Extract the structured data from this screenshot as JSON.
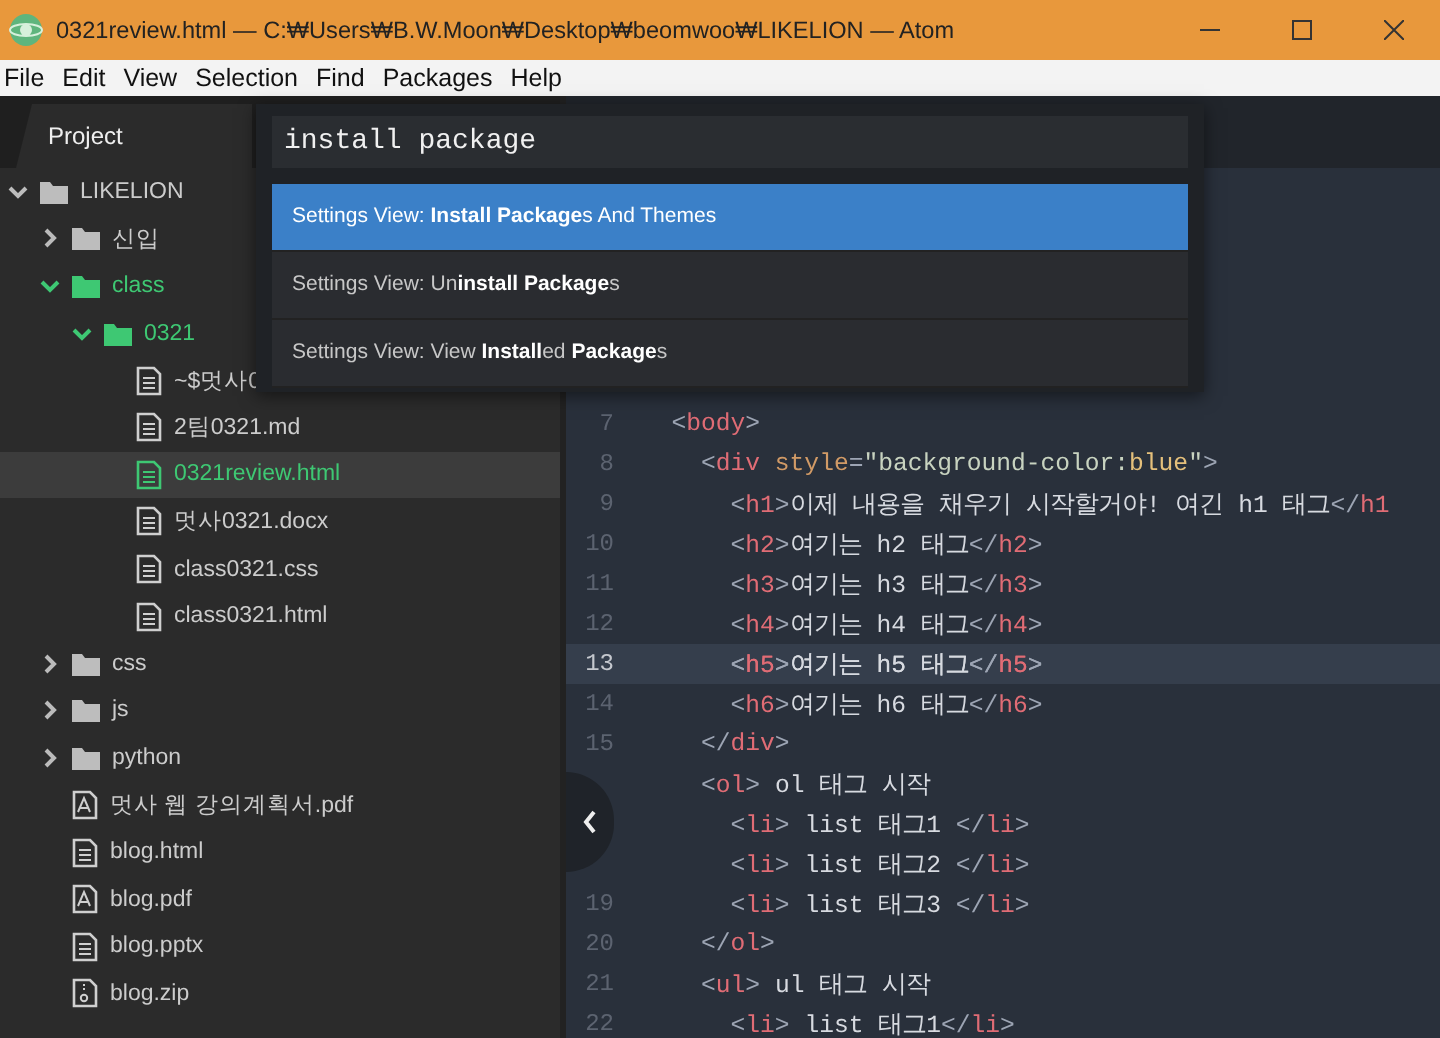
{
  "window": {
    "title": "0321review.html — C:₩Users₩B.W.Moon₩Desktop₩beomwoo₩LIKELION — Atom"
  },
  "menu": [
    "File",
    "Edit",
    "View",
    "Selection",
    "Find",
    "Packages",
    "Help"
  ],
  "sidebar": {
    "tab": "Project"
  },
  "tree": [
    {
      "label": "LIKELION",
      "kind": "folder",
      "expanded": true,
      "selected": false,
      "added": false,
      "children": [
        {
          "label": "신입",
          "kind": "folder",
          "expanded": false,
          "selected": false,
          "added": false
        },
        {
          "label": "class",
          "kind": "folder",
          "expanded": true,
          "selected": false,
          "added": true,
          "children": [
            {
              "label": "0321",
              "kind": "folder",
              "expanded": true,
              "selected": false,
              "added": true,
              "children": [
                {
                  "label": "~$멋사0",
                  "kind": "file",
                  "selected": false,
                  "added": false
                },
                {
                  "label": "2팀0321.md",
                  "kind": "file",
                  "selected": false,
                  "added": false
                },
                {
                  "label": "0321review.html",
                  "kind": "file",
                  "selected": true,
                  "added": true
                },
                {
                  "label": "멋사0321.docx",
                  "kind": "file",
                  "selected": false,
                  "added": false
                },
                {
                  "label": "class0321.css",
                  "kind": "file",
                  "selected": false,
                  "added": false
                },
                {
                  "label": "class0321.html",
                  "kind": "file",
                  "selected": false,
                  "added": false
                }
              ]
            }
          ]
        },
        {
          "label": "css",
          "kind": "folder",
          "expanded": false,
          "selected": false,
          "added": false
        },
        {
          "label": "js",
          "kind": "folder",
          "expanded": false,
          "selected": false,
          "added": false
        },
        {
          "label": "python",
          "kind": "folder",
          "expanded": false,
          "selected": false,
          "added": false
        },
        {
          "label": "멋사 웹 강의계획서.pdf",
          "kind": "pdf",
          "selected": false,
          "added": false
        },
        {
          "label": "blog.html",
          "kind": "file",
          "selected": false,
          "added": false
        },
        {
          "label": "blog.pdf",
          "kind": "pdf",
          "selected": false,
          "added": false
        },
        {
          "label": "blog.pptx",
          "kind": "file",
          "selected": false,
          "added": false
        },
        {
          "label": "blog.zip",
          "kind": "zip",
          "selected": false,
          "added": false
        }
      ]
    }
  ],
  "palette": {
    "value": "install package",
    "items": [
      {
        "label": "Settings View: **Install Package**s And Themes",
        "selected": true
      },
      {
        "label": "Settings View: Un**install Package**s",
        "selected": false
      },
      {
        "label": "Settings View: View **Install**ed **Package**s",
        "selected": false
      }
    ]
  },
  "editor": {
    "lines": [
      {
        "number": "7",
        "current": false,
        "tokens": [
          {
            "kind": "punct",
            "text": "  <"
          },
          {
            "kind": "tag",
            "text": "body"
          },
          {
            "kind": "punct",
            "text": ">"
          }
        ]
      },
      {
        "number": "8",
        "current": false,
        "tokens": [
          {
            "kind": "punct",
            "text": "    <"
          },
          {
            "kind": "tag",
            "text": "div"
          },
          {
            "kind": "attr",
            "text": " style"
          },
          {
            "kind": "punct",
            "text": "="
          },
          {
            "kind": "string",
            "text": "\"background-color:"
          },
          {
            "kind": "value",
            "text": "blue"
          },
          {
            "kind": "string",
            "text": "\""
          },
          {
            "kind": "punct",
            "text": ">"
          }
        ]
      },
      {
        "number": "9",
        "current": false,
        "tokens": [
          {
            "kind": "punct",
            "text": "      <"
          },
          {
            "kind": "tag",
            "text": "h1"
          },
          {
            "kind": "punct",
            "text": ">"
          },
          {
            "kind": "text",
            "text": "이제 내용을 채우기 시작할거야! 여긴 h1 태그"
          },
          {
            "kind": "punct",
            "text": "</"
          },
          {
            "kind": "tag",
            "text": "h1"
          }
        ]
      },
      {
        "number": "10",
        "current": false,
        "tokens": [
          {
            "kind": "punct",
            "text": "      <"
          },
          {
            "kind": "tag",
            "text": "h2"
          },
          {
            "kind": "punct",
            "text": ">"
          },
          {
            "kind": "text",
            "text": "여기는 h2 태그"
          },
          {
            "kind": "punct",
            "text": "</"
          },
          {
            "kind": "tag",
            "text": "h2"
          },
          {
            "kind": "punct",
            "text": ">"
          }
        ]
      },
      {
        "number": "11",
        "current": false,
        "tokens": [
          {
            "kind": "punct",
            "text": "      <"
          },
          {
            "kind": "tag",
            "text": "h3"
          },
          {
            "kind": "punct",
            "text": ">"
          },
          {
            "kind": "text",
            "text": "여기는 h3 태그"
          },
          {
            "kind": "punct",
            "text": "</"
          },
          {
            "kind": "tag",
            "text": "h3"
          },
          {
            "kind": "punct",
            "text": ">"
          }
        ]
      },
      {
        "number": "12",
        "current": false,
        "tokens": [
          {
            "kind": "punct",
            "text": "      <"
          },
          {
            "kind": "tag",
            "text": "h4"
          },
          {
            "kind": "punct",
            "text": ">"
          },
          {
            "kind": "text",
            "text": "여기는 h4 태그"
          },
          {
            "kind": "punct",
            "text": "</"
          },
          {
            "kind": "tag",
            "text": "h4"
          },
          {
            "kind": "punct",
            "text": ">"
          }
        ]
      },
      {
        "number": "13",
        "current": true,
        "tokens": [
          {
            "kind": "punct",
            "text": "      <"
          },
          {
            "kind": "tag",
            "text": "h5"
          },
          {
            "kind": "punct",
            "text": ">"
          },
          {
            "kind": "text",
            "text": "여기는 h5 태그"
          },
          {
            "kind": "punct",
            "text": "</"
          },
          {
            "kind": "tag",
            "text": "h5"
          },
          {
            "kind": "punct",
            "text": ">"
          }
        ]
      },
      {
        "number": "14",
        "current": false,
        "tokens": [
          {
            "kind": "punct",
            "text": "      <"
          },
          {
            "kind": "tag",
            "text": "h6"
          },
          {
            "kind": "punct",
            "text": ">"
          },
          {
            "kind": "text",
            "text": "여기는 h6 태그"
          },
          {
            "kind": "punct",
            "text": "</"
          },
          {
            "kind": "tag",
            "text": "h6"
          },
          {
            "kind": "punct",
            "text": ">"
          }
        ]
      },
      {
        "number": "15",
        "current": false,
        "tokens": [
          {
            "kind": "punct",
            "text": "    </"
          },
          {
            "kind": "tag",
            "text": "div"
          },
          {
            "kind": "punct",
            "text": ">"
          }
        ]
      },
      {
        "current": false,
        "tokens": [
          {
            "kind": "punct",
            "text": "    <"
          },
          {
            "kind": "tag",
            "text": "ol"
          },
          {
            "kind": "punct",
            "text": ">"
          },
          {
            "kind": "text",
            "text": " ol 태그 시작"
          }
        ]
      },
      {
        "current": false,
        "tokens": [
          {
            "kind": "punct",
            "text": "      <"
          },
          {
            "kind": "tag",
            "text": "li"
          },
          {
            "kind": "punct",
            "text": ">"
          },
          {
            "kind": "text",
            "text": " list 태그1 "
          },
          {
            "kind": "punct",
            "text": "</"
          },
          {
            "kind": "tag",
            "text": "li"
          },
          {
            "kind": "punct",
            "text": ">"
          }
        ]
      },
      {
        "current": false,
        "tokens": [
          {
            "kind": "punct",
            "text": "      <"
          },
          {
            "kind": "tag",
            "text": "li"
          },
          {
            "kind": "punct",
            "text": ">"
          },
          {
            "kind": "text",
            "text": " list 태그2 "
          },
          {
            "kind": "punct",
            "text": "</"
          },
          {
            "kind": "tag",
            "text": "li"
          },
          {
            "kind": "punct",
            "text": ">"
          }
        ]
      },
      {
        "number": "19",
        "current": false,
        "tokens": [
          {
            "kind": "punct",
            "text": "      <"
          },
          {
            "kind": "tag",
            "text": "li"
          },
          {
            "kind": "punct",
            "text": ">"
          },
          {
            "kind": "text",
            "text": " list 태그3 "
          },
          {
            "kind": "punct",
            "text": "</"
          },
          {
            "kind": "tag",
            "text": "li"
          },
          {
            "kind": "punct",
            "text": ">"
          }
        ]
      },
      {
        "number": "20",
        "current": false,
        "tokens": [
          {
            "kind": "punct",
            "text": "    </"
          },
          {
            "kind": "tag",
            "text": "ol"
          },
          {
            "kind": "punct",
            "text": ">"
          }
        ]
      },
      {
        "number": "21",
        "current": false,
        "tokens": [
          {
            "kind": "punct",
            "text": "    <"
          },
          {
            "kind": "tag",
            "text": "ul"
          },
          {
            "kind": "punct",
            "text": ">"
          },
          {
            "kind": "text",
            "text": " ul 태그 시작"
          }
        ]
      },
      {
        "number": "22",
        "current": false,
        "tokens": [
          {
            "kind": "punct",
            "text": "      <"
          },
          {
            "kind": "tag",
            "text": "li"
          },
          {
            "kind": "punct",
            "text": ">"
          },
          {
            "kind": "text",
            "text": " list 태그1"
          },
          {
            "kind": "punct",
            "text": "</"
          },
          {
            "kind": "tag",
            "text": "li"
          },
          {
            "kind": "punct",
            "text": ">"
          }
        ]
      }
    ]
  }
}
